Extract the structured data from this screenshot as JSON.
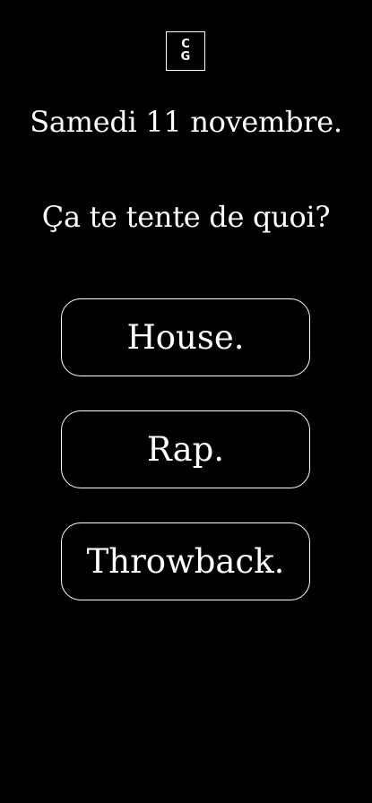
{
  "logo": {
    "line1": "C",
    "line2": "G"
  },
  "date": "Samedi 11 novembre.",
  "question": "Ça te tente de quoi?",
  "choices": [
    {
      "label": "House."
    },
    {
      "label": "Rap."
    },
    {
      "label": "Throwback."
    }
  ],
  "colors": {
    "background": "#000000",
    "text": "#ffffff",
    "border": "#ffffff"
  }
}
